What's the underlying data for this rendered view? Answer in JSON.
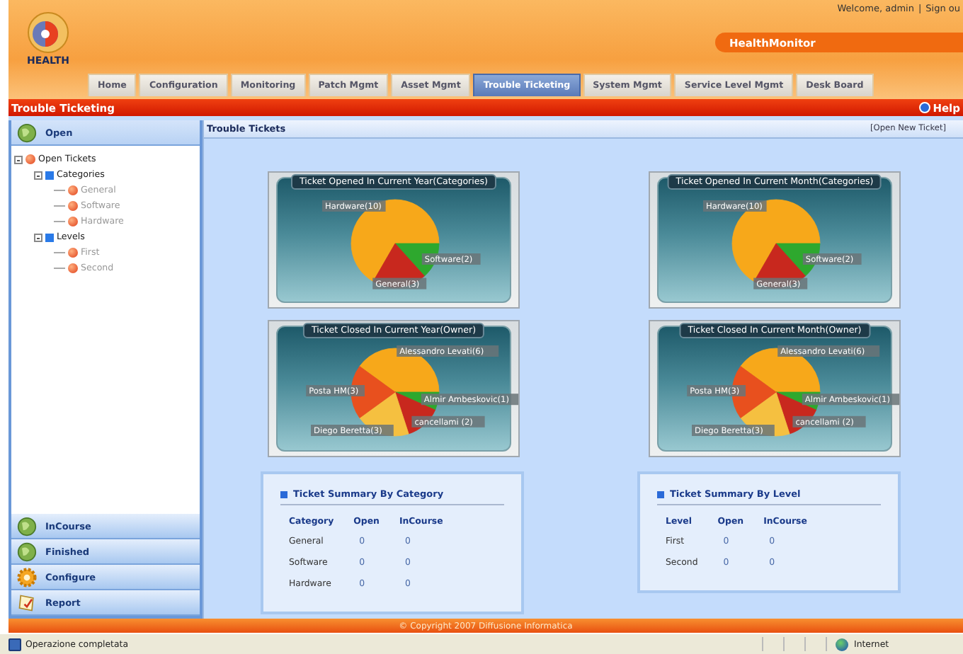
{
  "header": {
    "logo_text": "HEALTH",
    "welcome": "Welcome, admin",
    "separator": "|",
    "sign_out": "Sign ou",
    "app_name": "HealthMonitor"
  },
  "tabs": [
    {
      "label": "Home",
      "selected": false
    },
    {
      "label": "Configuration",
      "selected": false
    },
    {
      "label": "Monitoring",
      "selected": false
    },
    {
      "label": "Patch Mgmt",
      "selected": false
    },
    {
      "label": "Asset Mgmt",
      "selected": false
    },
    {
      "label": "Trouble Ticketing",
      "selected": true
    },
    {
      "label": "System Mgmt",
      "selected": false
    },
    {
      "label": "Service Level Mgmt",
      "selected": false
    },
    {
      "label": "Desk Board",
      "selected": false
    }
  ],
  "section_bar": {
    "title": "Trouble Ticketing",
    "help": "Help"
  },
  "sidebar": {
    "panels": [
      {
        "label": "Open",
        "selected": true
      },
      {
        "label": "InCourse",
        "selected": false
      },
      {
        "label": "Finished",
        "selected": false
      },
      {
        "label": "Configure",
        "selected": false
      },
      {
        "label": "Report",
        "selected": false
      }
    ],
    "tree": [
      {
        "label": "Open Tickets",
        "kind": "ticket",
        "expanded": true,
        "children": [
          {
            "label": "Categories",
            "kind": "group",
            "expanded": true,
            "children": [
              {
                "label": "General",
                "kind": "ticket"
              },
              {
                "label": "Software",
                "kind": "ticket"
              },
              {
                "label": "Hardware",
                "kind": "ticket"
              }
            ]
          },
          {
            "label": "Levels",
            "kind": "group",
            "expanded": true,
            "children": [
              {
                "label": "First",
                "kind": "ticket"
              },
              {
                "label": "Second",
                "kind": "ticket"
              }
            ]
          }
        ]
      }
    ]
  },
  "main": {
    "title": "Trouble Tickets",
    "action": "[Open New Ticket]",
    "charts": [
      {
        "chart_data": {
          "type": "pie",
          "title": "Ticket Opened In Current Year(Categories)",
          "categories": [
            "Hardware(10)",
            "Software(2)",
            "General(3)"
          ],
          "values": [
            10,
            2,
            3
          ],
          "colors": [
            "#f7a81a",
            "#2ea82e",
            "#c8281e"
          ]
        }
      },
      {
        "chart_data": {
          "type": "pie",
          "title": "Ticket Opened In Current Month(Categories)",
          "categories": [
            "Hardware(10)",
            "Software(2)",
            "General(3)"
          ],
          "values": [
            10,
            2,
            3
          ],
          "colors": [
            "#f7a81a",
            "#2ea82e",
            "#c8281e"
          ]
        }
      },
      {
        "chart_data": {
          "type": "pie",
          "title": "Ticket Closed In Current Year(Owner)",
          "categories": [
            "Alessandro Levati(6)",
            "Almir Ambeskovic(1)",
            "cancellami (2)",
            "Diego Beretta(3)",
            "Posta HM(3)"
          ],
          "values": [
            6,
            1,
            2,
            3,
            3
          ],
          "colors": [
            "#f7a81a",
            "#2ea82e",
            "#c8281e",
            "#f5c040",
            "#e8501e"
          ]
        }
      },
      {
        "chart_data": {
          "type": "pie",
          "title": "Ticket Closed In Current Month(Owner)",
          "categories": [
            "Alessandro Levati(6)",
            "Almir Ambeskovic(1)",
            "cancellami (2)",
            "Diego Beretta(3)",
            "Posta HM(3)"
          ],
          "values": [
            6,
            1,
            2,
            3,
            3
          ],
          "colors": [
            "#f7a81a",
            "#2ea82e",
            "#c8281e",
            "#f5c040",
            "#e8501e"
          ]
        }
      }
    ],
    "summaries": [
      {
        "title": "Ticket Summary By Category",
        "columns": [
          "Category",
          "Open",
          "InCourse"
        ],
        "rows": [
          [
            "General",
            "0",
            "0"
          ],
          [
            "Software",
            "0",
            "0"
          ],
          [
            "Hardware",
            "0",
            "0"
          ]
        ]
      },
      {
        "title": "Ticket Summary By Level",
        "columns": [
          "Level",
          "Open",
          "InCourse"
        ],
        "rows": [
          [
            "First",
            "0",
            "0"
          ],
          [
            "Second",
            "0",
            "0"
          ]
        ]
      }
    ]
  },
  "footer": {
    "copyright": "© Copyright 2007 Diffusione Informatica"
  },
  "status_bar": {
    "message": "Operazione completata",
    "zone": "Internet"
  }
}
